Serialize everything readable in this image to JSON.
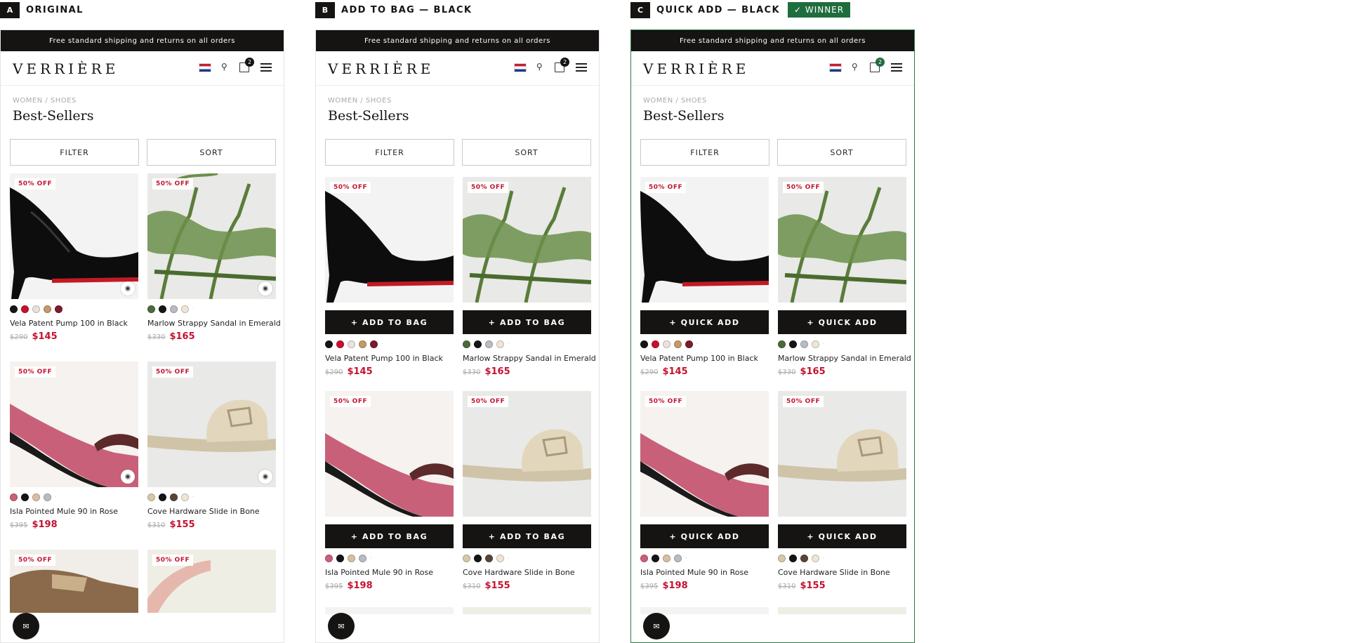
{
  "variants": [
    {
      "letter": "A",
      "title": "ORIGINAL",
      "winner": ""
    },
    {
      "letter": "B",
      "title": "ADD TO BAG — BLACK",
      "winner": ""
    },
    {
      "letter": "C",
      "title": "QUICK ADD — BLACK",
      "winner": "✓ WINNER"
    }
  ],
  "store": {
    "promo": "Free standard shipping and returns on all orders",
    "logo": "VERRIÈRE",
    "bag_count": "2",
    "breadcrumb": "WOMEN / SHOES",
    "page_title": "Best-Sellers",
    "filter_label": "FILTER",
    "sort_label": "SORT",
    "chat_icon": "✉"
  },
  "buttons": {
    "b_label": "+ ADD TO BAG",
    "c_label": "+ QUICK ADD"
  },
  "products": [
    {
      "badge": "50% OFF",
      "name": "Vela Patent Pump 100 in Black",
      "was": "$290",
      "price": "$145",
      "swatches": [
        "#151515",
        "#c8102e",
        "#e8e4dc",
        "#c39a6b",
        "#7b1b2c"
      ],
      "more": "·"
    },
    {
      "badge": "50% OFF",
      "name": "Marlow Strappy Sandal in Emerald",
      "was": "$330",
      "price": "$165",
      "swatches": [
        "#4a6b3a",
        "#151515",
        "#b9bcc2",
        "#efe6d6"
      ],
      "more": "·"
    },
    {
      "badge": "50% OFF",
      "name": "Isla Pointed Mule 90 in Rose",
      "was": "$395",
      "price": "$198",
      "swatches": [
        "#c9607a",
        "#151515",
        "#d9bfa2",
        "#b9bcc2"
      ],
      "more": "·"
    },
    {
      "badge": "50% OFF",
      "name": "Cove Hardware Slide in Bone",
      "was": "$310",
      "price": "$155",
      "swatches": [
        "#d8c8a8",
        "#151515",
        "#5a4535",
        "#efe6d6"
      ],
      "more": "·"
    },
    {
      "badge": "50% OFF"
    },
    {
      "badge": "50% OFF"
    }
  ]
}
